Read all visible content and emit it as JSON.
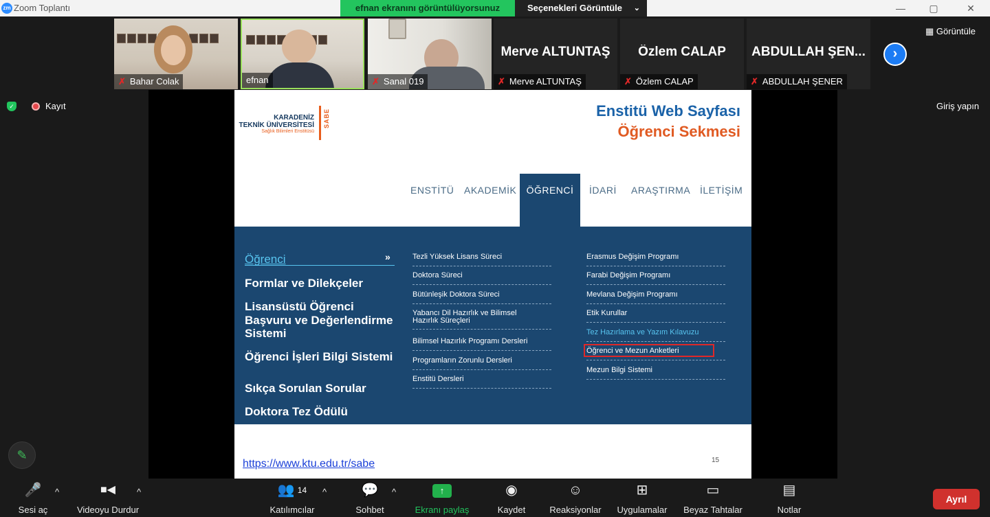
{
  "window": {
    "app_title": "Zoom Toplantı",
    "logo_text": "zm",
    "minimize": "—",
    "maximize": "▢",
    "close": "✕"
  },
  "share_banner": {
    "status": "efnan ekranını görüntülüyorsunuz",
    "options": "Seçenekleri Görüntüle",
    "options_caret": "⌄"
  },
  "gallery": {
    "participants": [
      {
        "name": "Bahar Colak",
        "video": true,
        "muted": true
      },
      {
        "name": "efnan",
        "video": true,
        "muted": false,
        "active_speaker": true
      },
      {
        "name": "Sanal 019",
        "video": true,
        "muted": true
      },
      {
        "name": "Merve ALTUNTAŞ",
        "display": "Merve ALTUNTAŞ",
        "video": false,
        "muted": true
      },
      {
        "name": "Özlem CALAP",
        "display": "Özlem CALAP",
        "video": false,
        "muted": true
      },
      {
        "name": "ABDULLAH ŞENER",
        "display": "ABDULLAH ŞEN...",
        "video": false,
        "muted": true
      }
    ],
    "next_icon": "›",
    "view_label": "Görüntüle"
  },
  "header_right": {
    "signin": "Giriş yapın"
  },
  "recording": {
    "label": "Kayıt",
    "shield_glyph": "✓"
  },
  "slide": {
    "logo": {
      "line1": "KARADENİZ",
      "line2": "TEKNİK ÜNİVERSİTESİ",
      "line3": "Sağlık Bilimleri Enstitüsü",
      "side": "SABE"
    },
    "title1": "Enstitü Web Sayfası",
    "title2": "Öğrenci Sekmesi",
    "nav": [
      "ENSTİTÜ",
      "AKADEMİK",
      "ÖĞRENCİ",
      "İDARİ",
      "ARAŞTIRMA",
      "İLETİŞİM"
    ],
    "active_nav": "ÖĞRENCİ",
    "left_links": [
      "Öğrenci",
      "Formlar ve Dilekçeler",
      "Lisansüstü Öğrenci",
      "Başvuru ve Değerlendirme",
      "Sistemi",
      "Öğrenci İşleri Bilgi Sistemi",
      "Sıkça Sorulan Sorular",
      "Doktora Tez Ödülü"
    ],
    "left_arrow": "»",
    "middle_column": [
      "Tezli Yüksek Lisans Süreci",
      "Doktora Süreci",
      "Bütünleşik Doktora Süreci",
      "Yabancı Dil Hazırlık ve Bilimsel",
      "Hazırlık Süreçleri",
      "Bilimsel Hazırlık Programı Dersleri",
      "Programların Zorunlu Dersleri",
      "Enstitü Dersleri"
    ],
    "right_column": [
      "Erasmus Değişim Programı",
      "Farabi Değişim Programı",
      "Mevlana Değişim Programı",
      "Etik Kurullar",
      "Tez Hazırlama ve Yazım Kılavuzu",
      "Öğrenci ve Mezun Anketleri",
      "Mezun Bilgi Sistemi"
    ],
    "url": "https://www.ktu.edu.tr/sabe",
    "page_number": "15"
  },
  "annotate_icon": "✎",
  "toolbar": {
    "mute": {
      "label": "Sesi aç",
      "icon": "🎤"
    },
    "video": {
      "label": "Videoyu Durdur",
      "icon": "■◀"
    },
    "participants": {
      "label": "Katılımcılar",
      "icon": "👥",
      "count": "14"
    },
    "chat": {
      "label": "Sohbet",
      "icon": "💬"
    },
    "share": {
      "label": "Ekranı paylaş",
      "icon": "↑"
    },
    "record": {
      "label": "Kaydet",
      "icon": "◉"
    },
    "reactions": {
      "label": "Reaksiyonlar",
      "icon": "☺"
    },
    "apps": {
      "label": "Uygulamalar",
      "icon": "⊞"
    },
    "whiteboard": {
      "label": "Beyaz Tahtalar",
      "icon": "▭"
    },
    "notes": {
      "label": "Notlar",
      "icon": "▤"
    },
    "caret": "^",
    "leave": "Ayrıl"
  },
  "colors": {
    "share_green": "#23c55e",
    "panel_blue": "#1b4770",
    "title_blue": "#1a62a8",
    "title_orange": "#e05a22",
    "leave_red": "#d0312d",
    "link_blue": "#58c5f0"
  }
}
